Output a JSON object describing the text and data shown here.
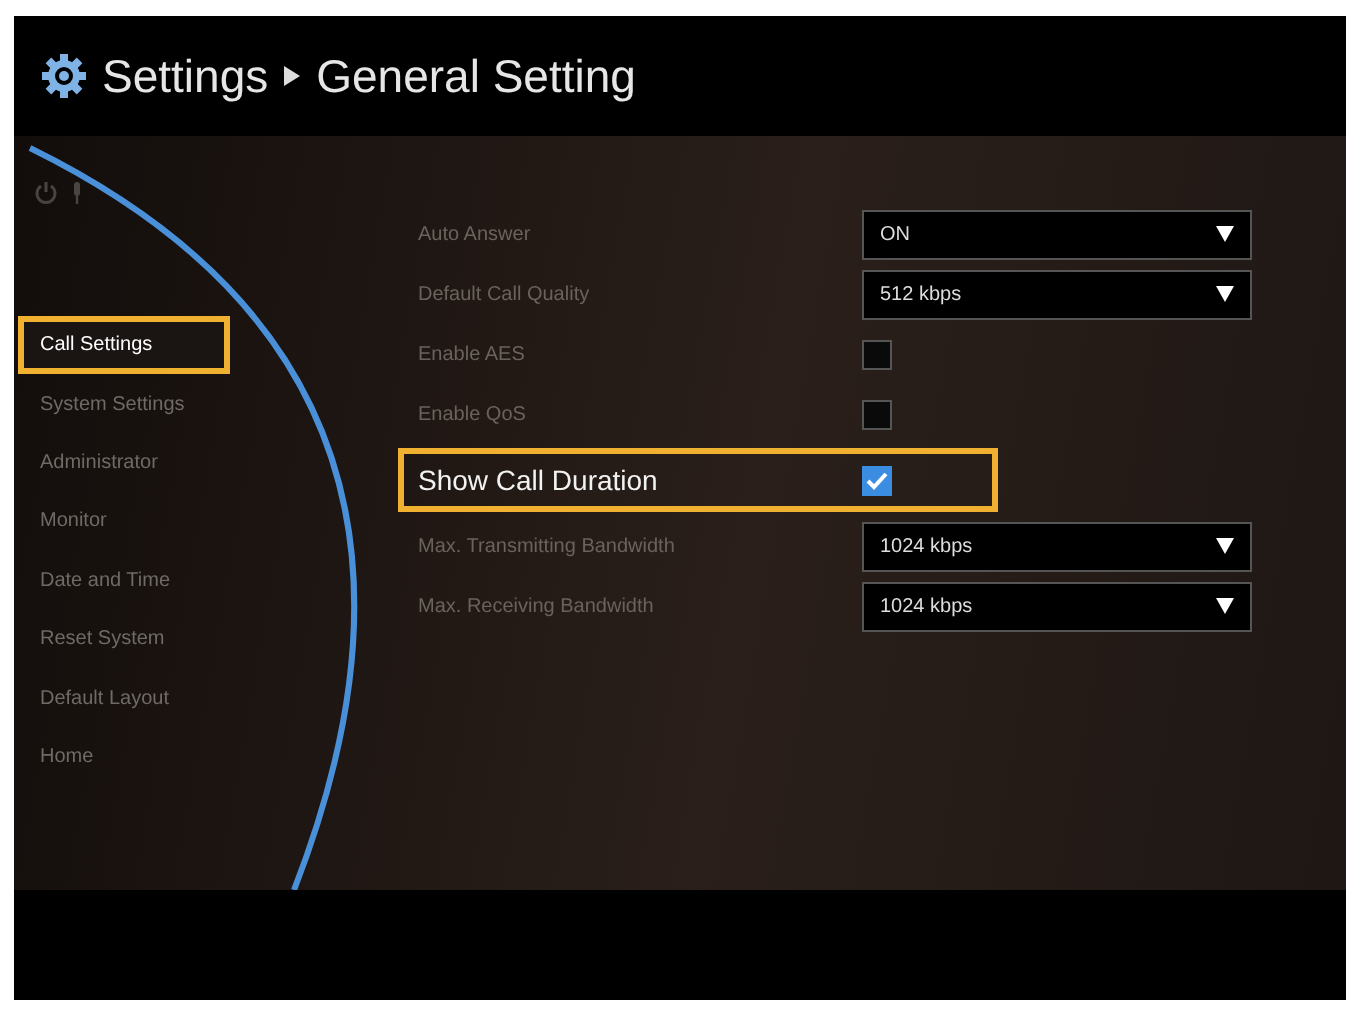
{
  "header": {
    "title": "Settings",
    "current": "General Setting"
  },
  "sidebar": {
    "items": [
      {
        "label": "Call Settings",
        "selected": true
      },
      {
        "label": "System Settings",
        "selected": false
      },
      {
        "label": "Administrator",
        "selected": false
      },
      {
        "label": "Monitor",
        "selected": false
      },
      {
        "label": "Date and Time",
        "selected": false
      },
      {
        "label": "Reset System",
        "selected": false
      },
      {
        "label": "Default Layout",
        "selected": false
      },
      {
        "label": "Home",
        "selected": false
      }
    ]
  },
  "settings": [
    {
      "kind": "dropdown",
      "label": "Auto Answer",
      "value": "ON",
      "selected": false
    },
    {
      "kind": "dropdown",
      "label": "Default Call Quality",
      "value": "512 kbps",
      "selected": false
    },
    {
      "kind": "checkbox",
      "label": "Enable AES",
      "checked": false,
      "selected": false
    },
    {
      "kind": "checkbox",
      "label": "Enable QoS",
      "checked": false,
      "selected": false
    },
    {
      "kind": "checkbox",
      "label": "Show Call Duration",
      "checked": true,
      "selected": true
    },
    {
      "kind": "dropdown",
      "label": "Max. Transmitting Bandwidth",
      "value": "1024 kbps",
      "selected": false
    },
    {
      "kind": "dropdown",
      "label": "Max. Receiving Bandwidth",
      "value": "1024 kbps",
      "selected": false
    }
  ]
}
